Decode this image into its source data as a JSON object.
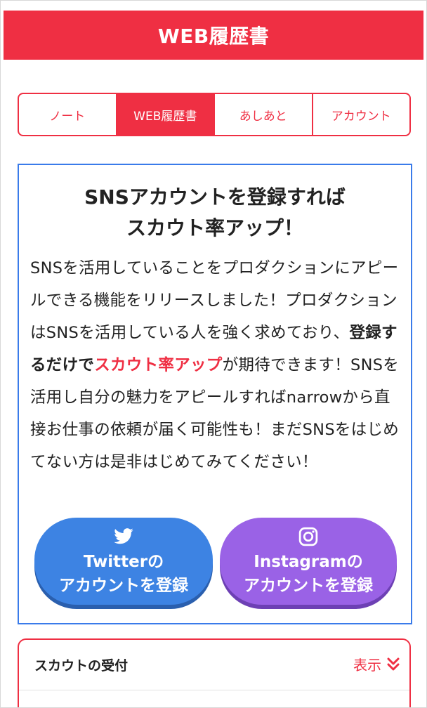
{
  "header": {
    "title": "WEB履歴書"
  },
  "tabs": [
    {
      "label": "ノート",
      "active": false
    },
    {
      "label": "WEB履歴書",
      "active": true
    },
    {
      "label": "あしあと",
      "active": false
    },
    {
      "label": "アカウント",
      "active": false
    }
  ],
  "promo": {
    "title_line1": "SNSアカウントを登録すれば",
    "title_line2": "スカウト率アップ！",
    "body_1": "SNSを活用していることをプロダクションにアピールできる機能をリリースしました！プロダクションはSNSを活用している人を強く求めており、",
    "body_bold": "登録するだけで",
    "body_red": "スカウト率アップ",
    "body_2": "が期待できます！SNSを活用し自分の魅力をアピールすればnarrowから直接お仕事の依頼が届く可能性も！まだSNSをはじめてない方は是非はじめてみてください！"
  },
  "buttons": {
    "twitter_line1": "Twitterの",
    "twitter_line2": "アカウントを登録",
    "instagram_line1": "Instagramの",
    "instagram_line2": "アカウントを登録"
  },
  "scout": {
    "title": "スカウトの受付",
    "toggle_label": "表示"
  },
  "colors": {
    "brand_red": "#ef2f43",
    "promo_border": "#3a7bea",
    "twitter_blue": "#3d83e3",
    "instagram_purple": "#9a62e6"
  },
  "icons": [
    "twitter-icon",
    "instagram-icon",
    "chevron-double-down-icon"
  ]
}
